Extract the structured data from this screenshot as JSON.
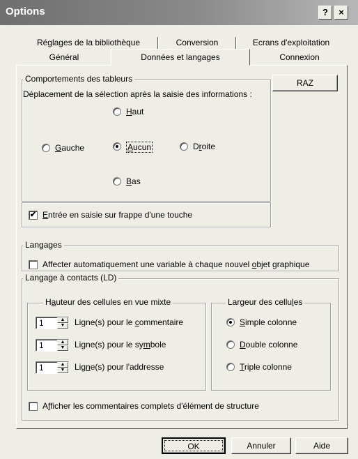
{
  "window": {
    "title": "Options",
    "help_glyph": "?",
    "close_glyph": "×"
  },
  "tabs": {
    "back_row": [
      "Réglages de la bibliothèque",
      "Conversion",
      "Ecrans d'exploitation"
    ],
    "front_row": [
      "Général",
      "Données et langages",
      "Connexion"
    ],
    "active": "Données et langages"
  },
  "tableurs": {
    "group_label": "Comportements des tableurs",
    "deplacement_label": "Déplacement de la sélection après la saisie des informations :",
    "radios": {
      "haut": {
        "pre": "",
        "key": "H",
        "post": "aut"
      },
      "gauche": {
        "pre": "",
        "key": "G",
        "post": "auche"
      },
      "aucun": {
        "pre": "",
        "key": "A",
        "post": "ucun"
      },
      "droite": {
        "pre": "D",
        "key": "r",
        "post": "oite"
      },
      "bas": {
        "pre": "",
        "key": "B",
        "post": "as"
      }
    },
    "selected": "aucun",
    "entree_check": {
      "pre": "",
      "key": "E",
      "post": "ntrée en saisie sur frappe d'une touche",
      "checked": true
    }
  },
  "raz_button": "RAZ",
  "langages": {
    "group_label": "Langages",
    "affecter_check": {
      "text_pre": "Affecter automatiquement une variable à chaque nouvel ",
      "key": "o",
      "text_post": "bjet graphique",
      "checked": false
    }
  },
  "ld": {
    "group_label": "Langage à contacts (LD)",
    "hauteur": {
      "label_pre": "H",
      "label_key": "a",
      "label_post": "uteur des cellules en vue mixte",
      "rows": [
        {
          "value": "1",
          "pre": "Ligne(s) pour le ",
          "key": "c",
          "post": "ommentaire"
        },
        {
          "value": "1",
          "pre": "Ligne(s) pour le sy",
          "key": "m",
          "post": "bole"
        },
        {
          "value": "1",
          "pre": "Lig",
          "key": "n",
          "post": "e(s) pour l'addresse"
        }
      ]
    },
    "largeur": {
      "label_pre": "Largeur des cellu",
      "label_key": "l",
      "label_post": "es",
      "options": [
        {
          "pre": "",
          "key": "S",
          "post": "imple colonne"
        },
        {
          "pre": "",
          "key": "D",
          "post": "ouble colonne"
        },
        {
          "pre": "",
          "key": "T",
          "post": "riple colonne"
        }
      ],
      "selected_index": 0
    },
    "afficher_check": {
      "pre": "A",
      "key": "f",
      "post": "ficher les commentaires complets d'élément de structure",
      "checked": false
    }
  },
  "footer": {
    "ok": "OK",
    "annuler": "Annuler",
    "aide": "Aide"
  }
}
